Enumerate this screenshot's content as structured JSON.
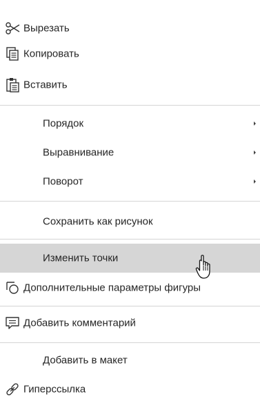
{
  "menu": {
    "items": [
      {
        "label": "Вырезать",
        "icon": "scissors-icon"
      },
      {
        "label": "Копировать",
        "icon": "copy-icon"
      },
      {
        "label": "Вставить",
        "icon": "paste-icon"
      },
      {
        "label": "Порядок",
        "submenu": true
      },
      {
        "label": "Выравнивание",
        "submenu": true
      },
      {
        "label": "Поворот",
        "submenu": true
      },
      {
        "label": "Сохранить как рисунок"
      },
      {
        "label": "Изменить точки",
        "highlighted": true
      },
      {
        "label": "Дополнительные параметры фигуры",
        "icon": "shape-properties-icon"
      },
      {
        "label": "Добавить комментарий",
        "icon": "comment-icon"
      },
      {
        "label": "Добавить в макет"
      },
      {
        "label": "Гиперссылка",
        "icon": "link-icon"
      }
    ]
  },
  "colors": {
    "hover_bg": "#d6d6d6",
    "separator": "#d4d4d4",
    "text": "#262626"
  }
}
